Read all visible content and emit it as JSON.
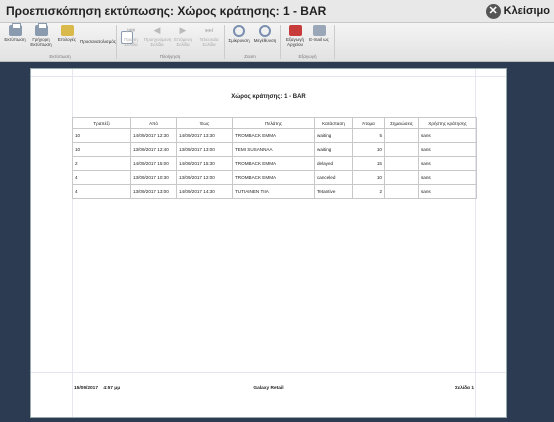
{
  "window": {
    "title": "Προεπισκόπηση εκτύπωσης: Χώρος κράτησης: 1 - BAR",
    "close_label": "Κλείσιμο"
  },
  "ribbon": {
    "buttons": [
      {
        "label": "Εκτύπωση",
        "icon": "printer-icon"
      },
      {
        "label": "Γρήγορη Εκτύπωση",
        "icon": "quick-print-icon"
      },
      {
        "label": "Επιλογές",
        "icon": "options-icon"
      },
      {
        "label": "Προσανατολισμός",
        "icon": "orientation-icon"
      },
      {
        "label": "Πρώτη Σελίδα",
        "icon": "first-page-icon"
      },
      {
        "label": "Προηγούμενη Σελίδα",
        "icon": "previous-page-icon"
      },
      {
        "label": "Επόμενη Σελίδα",
        "icon": "next-page-icon"
      },
      {
        "label": "Τελευταία Σελίδα",
        "icon": "last-page-icon"
      },
      {
        "label": "Σμίκρυνση",
        "icon": "zoom-out-icon"
      },
      {
        "label": "Μεγέθυνση",
        "icon": "zoom-in-icon"
      },
      {
        "label": "Εξαγωγή Αρχείου",
        "icon": "export-file-icon"
      },
      {
        "label": "E-mail ως",
        "icon": "email-icon"
      }
    ],
    "groups": [
      "Εκτύπωση",
      "Πλοήγηση",
      "Zoom",
      "Εξαγωγή"
    ]
  },
  "report": {
    "title": "Χώρος κράτησης: 1 - BAR",
    "columns": [
      "Τραπέζι",
      "Από",
      "Έως",
      "Πελάτης",
      "Κατάσταση",
      "Άτομα",
      "Σημειώσεις",
      "Χρήστης κράτησης"
    ],
    "rows": [
      [
        "10",
        "14/09/2017 12:30",
        "14/09/2017 13:30",
        "TROMBACK EMMA",
        "waiting",
        "5",
        "",
        "sans"
      ],
      [
        "10",
        "13/09/2017 12:40",
        "13/09/2017 13:00",
        "TEMI SUSANNAA",
        "waiting",
        "10",
        "",
        "sans"
      ],
      [
        "2",
        "14/09/2017 15:00",
        "14/09/2017 15:30",
        "TROMBACK EMMA",
        "delayed",
        "15",
        "",
        "sans"
      ],
      [
        "4",
        "13/09/2017 10:30",
        "13/09/2017 12:00",
        "TROMBACK EMMA",
        "canceled",
        "10",
        "",
        "sans"
      ],
      [
        "4",
        "13/09/2017 13:00",
        "14/09/2017 14:30",
        "TUTIAINEN TIIA",
        "Tetantive",
        "2",
        "",
        "sans"
      ]
    ],
    "footer": {
      "date": "15/09/2017",
      "time": "4:57 μμ",
      "company": "Galaxy Retail",
      "page": "Σελίδα 1"
    }
  },
  "colors": {
    "viewer_background": "#2c3a52",
    "ribbon_background": "#e8e8e8",
    "close_button": "#555555"
  }
}
